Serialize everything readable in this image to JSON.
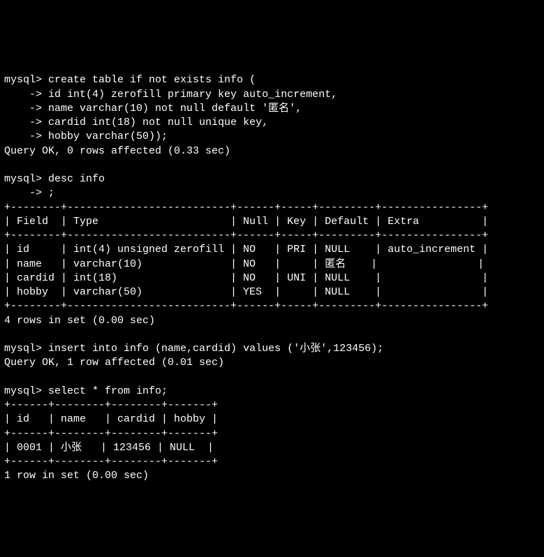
{
  "prompt": "mysql>",
  "cont": "    ->",
  "create": {
    "l1": " create table if not exists info (",
    "l2": " id int(4) zerofill primary key auto_increment,",
    "l3": " name varchar(10) not null default '匿名',",
    "l4": " cardid int(18) not null unique key,",
    "l5": " hobby varchar(50));",
    "result": "Query OK, 0 rows affected (0.33 sec)"
  },
  "desc": {
    "cmd": " desc info",
    "semi": " ;",
    "border": "+--------+--------------------------+------+-----+---------+----------------+",
    "header": "| Field  | Type                     | Null | Key | Default | Extra          |",
    "rows": [
      "| id     | int(4) unsigned zerofill | NO   | PRI | NULL    | auto_increment |",
      "| name   | varchar(10)              | NO   |     | 匿名    |                |",
      "| cardid | int(18)                  | NO   | UNI | NULL    |                |",
      "| hobby  | varchar(50)              | YES  |     | NULL    |                |"
    ],
    "result": "4 rows in set (0.00 sec)"
  },
  "insert": {
    "cmd": " insert into info (name,cardid) values ('小张',123456);",
    "result": "Query OK, 1 row affected (0.01 sec)"
  },
  "select": {
    "cmd": " select * from info;",
    "border": "+------+--------+--------+-------+",
    "header": "| id   | name   | cardid | hobby |",
    "rows": [
      "| 0001 | 小张   | 123456 | NULL  |"
    ],
    "result": "1 row in set (0.00 sec)"
  },
  "chart_data": {
    "type": "table",
    "title": "desc info",
    "columns": [
      "Field",
      "Type",
      "Null",
      "Key",
      "Default",
      "Extra"
    ],
    "rows": [
      [
        "id",
        "int(4) unsigned zerofill",
        "NO",
        "PRI",
        "NULL",
        "auto_increment"
      ],
      [
        "name",
        "varchar(10)",
        "NO",
        "",
        "匿名",
        ""
      ],
      [
        "cardid",
        "int(18)",
        "NO",
        "UNI",
        "NULL",
        ""
      ],
      [
        "hobby",
        "varchar(50)",
        "YES",
        "",
        "NULL",
        ""
      ]
    ],
    "select_result": {
      "columns": [
        "id",
        "name",
        "cardid",
        "hobby"
      ],
      "rows": [
        [
          "0001",
          "小张",
          "123456",
          "NULL"
        ]
      ]
    }
  }
}
